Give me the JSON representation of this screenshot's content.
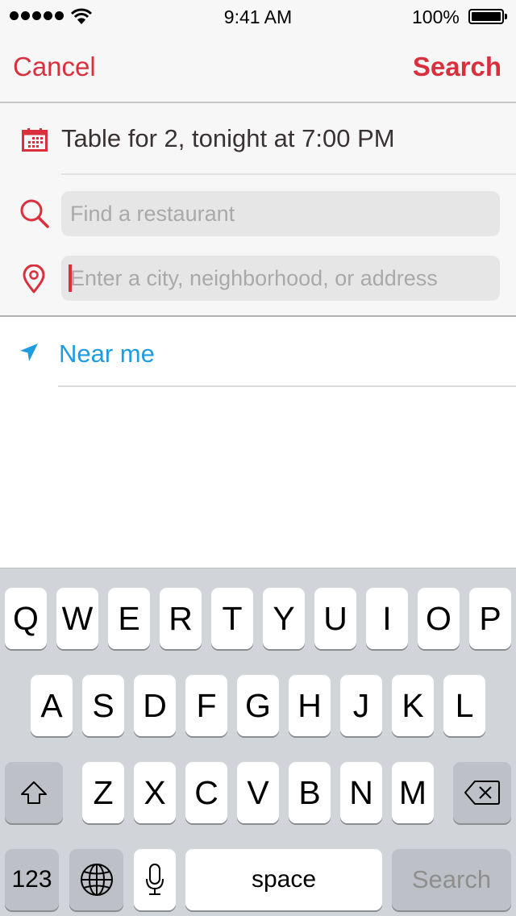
{
  "status_bar": {
    "signal_bars": 5,
    "time": "9:41 AM",
    "battery_percent": "100%",
    "battery_level": 1.0
  },
  "nav": {
    "cancel_label": "Cancel",
    "search_label": "Search"
  },
  "form": {
    "reservation": {
      "icon": "calendar-icon",
      "text": "Table for 2, tonight at 7:00 PM"
    },
    "restaurant_field": {
      "icon": "search-icon",
      "value": "",
      "placeholder": "Find a restaurant"
    },
    "location_field": {
      "icon": "location-pin-icon",
      "value": "",
      "placeholder": "Enter a city, neighborhood, or address",
      "focused": true
    }
  },
  "suggestions": [
    {
      "icon": "location-arrow-icon",
      "label": "Near me"
    }
  ],
  "colors": {
    "accent_red": "#d9303e",
    "link_blue": "#1f9be2",
    "keyboard_bg": "#d1d4d9"
  },
  "keyboard": {
    "row1": [
      "Q",
      "W",
      "E",
      "R",
      "T",
      "Y",
      "U",
      "I",
      "O",
      "P"
    ],
    "row2": [
      "A",
      "S",
      "D",
      "F",
      "G",
      "H",
      "J",
      "K",
      "L"
    ],
    "row3": [
      "Z",
      "X",
      "C",
      "V",
      "B",
      "N",
      "M"
    ],
    "shift_icon": "shift-icon",
    "delete_icon": "delete-icon",
    "numbers_label": "123",
    "globe_icon": "globe-icon",
    "mic_icon": "microphone-icon",
    "space_label": "space",
    "return_label": "Search"
  }
}
